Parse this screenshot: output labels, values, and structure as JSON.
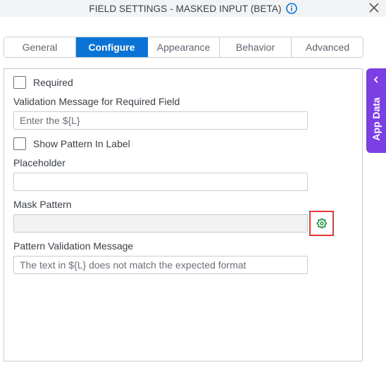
{
  "header": {
    "title": "FIELD SETTINGS - MASKED INPUT (BETA)",
    "info_icon": "info-circle-icon",
    "close_icon": "close-x-icon"
  },
  "tabs": [
    {
      "label": "General",
      "active": false
    },
    {
      "label": "Configure",
      "active": true
    },
    {
      "label": "Appearance",
      "active": false
    },
    {
      "label": "Behavior",
      "active": false
    },
    {
      "label": "Advanced",
      "active": false
    }
  ],
  "form": {
    "required": {
      "label": "Required",
      "checked": false
    },
    "validation_message": {
      "label": "Validation Message for Required Field",
      "value": "",
      "placeholder": "Enter the ${L}"
    },
    "show_pattern": {
      "label": "Show Pattern In Label",
      "checked": false
    },
    "placeholder_field": {
      "label": "Placeholder",
      "value": "",
      "placeholder": ""
    },
    "mask_pattern": {
      "label": "Mask Pattern",
      "value": "",
      "disabled": true,
      "settings_icon": "gear-icon"
    },
    "pattern_validation": {
      "label": "Pattern Validation Message",
      "value": "",
      "placeholder": "The text in ${L} does not match the expected format"
    }
  },
  "side_panel": {
    "label": "App Data",
    "icon": "chevron-left-icon"
  },
  "colors": {
    "accent": "#0a73d5",
    "side_panel": "#7b3fe4",
    "gear": "#1a8a3a",
    "highlight_border": "#e53935"
  }
}
